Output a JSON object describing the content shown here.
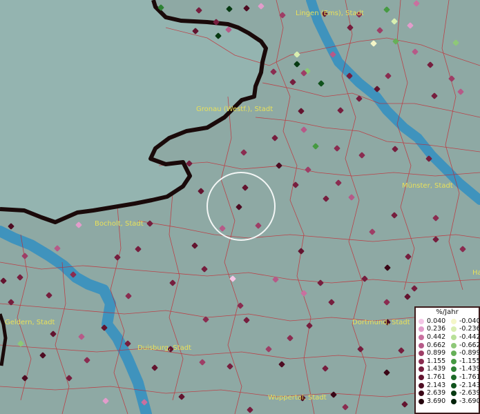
{
  "map": {
    "cities": [
      {
        "name": "Lingen (Ems), Stadt"
      },
      {
        "name": "Gronau (Westf.), Stadt"
      },
      {
        "name": "Münster, Stadt"
      },
      {
        "name": "Bocholt, Stadt"
      },
      {
        "name": "Geldern, Stadt"
      },
      {
        "name": "Dortmund, Stadt"
      },
      {
        "name": "Duisburg, Stadt"
      },
      {
        "name": "Wuppertal, Stadt"
      },
      {
        "name": "Ha"
      }
    ],
    "colors": {
      "land": "#8ea9a4",
      "netherlands": "#94b4b0",
      "river": "#3f93bd",
      "border": "#1a0a0a",
      "boundaries": "#c8202a"
    }
  },
  "legend": {
    "title": "%/Jahr",
    "positive": [
      {
        "value": "0.040",
        "color": "#f4c6e6"
      },
      {
        "value": "0.236",
        "color": "#e29ccb"
      },
      {
        "value": "0.442",
        "color": "#c9709f"
      },
      {
        "value": "0.662",
        "color": "#b65a88"
      },
      {
        "value": "0.899",
        "color": "#9e3e66"
      },
      {
        "value": "1.155",
        "color": "#8a2c50"
      },
      {
        "value": "1.439",
        "color": "#761e3e"
      },
      {
        "value": "1.761",
        "color": "#63142f"
      },
      {
        "value": "2.143",
        "color": "#4e0c22"
      },
      {
        "value": "2.639",
        "color": "#3a0616"
      },
      {
        "value": "3.690",
        "color": "#24030c"
      }
    ],
    "negative": [
      {
        "value": "-0.040",
        "color": "#f4f6c8"
      },
      {
        "value": "-0.236",
        "color": "#d8eeb0"
      },
      {
        "value": "-0.442",
        "color": "#b8e098"
      },
      {
        "value": "-0.662",
        "color": "#8ec878"
      },
      {
        "value": "-0.899",
        "color": "#66b058"
      },
      {
        "value": "-1.155",
        "color": "#469a42"
      },
      {
        "value": "-1.439",
        "color": "#2e8234"
      },
      {
        "value": "-1.761",
        "color": "#1d6a28"
      },
      {
        "value": "-2.143",
        "color": "#10521c"
      },
      {
        "value": "-2.639",
        "color": "#073a12"
      },
      {
        "value": "-3.690",
        "color": "#02220a"
      }
    ]
  }
}
